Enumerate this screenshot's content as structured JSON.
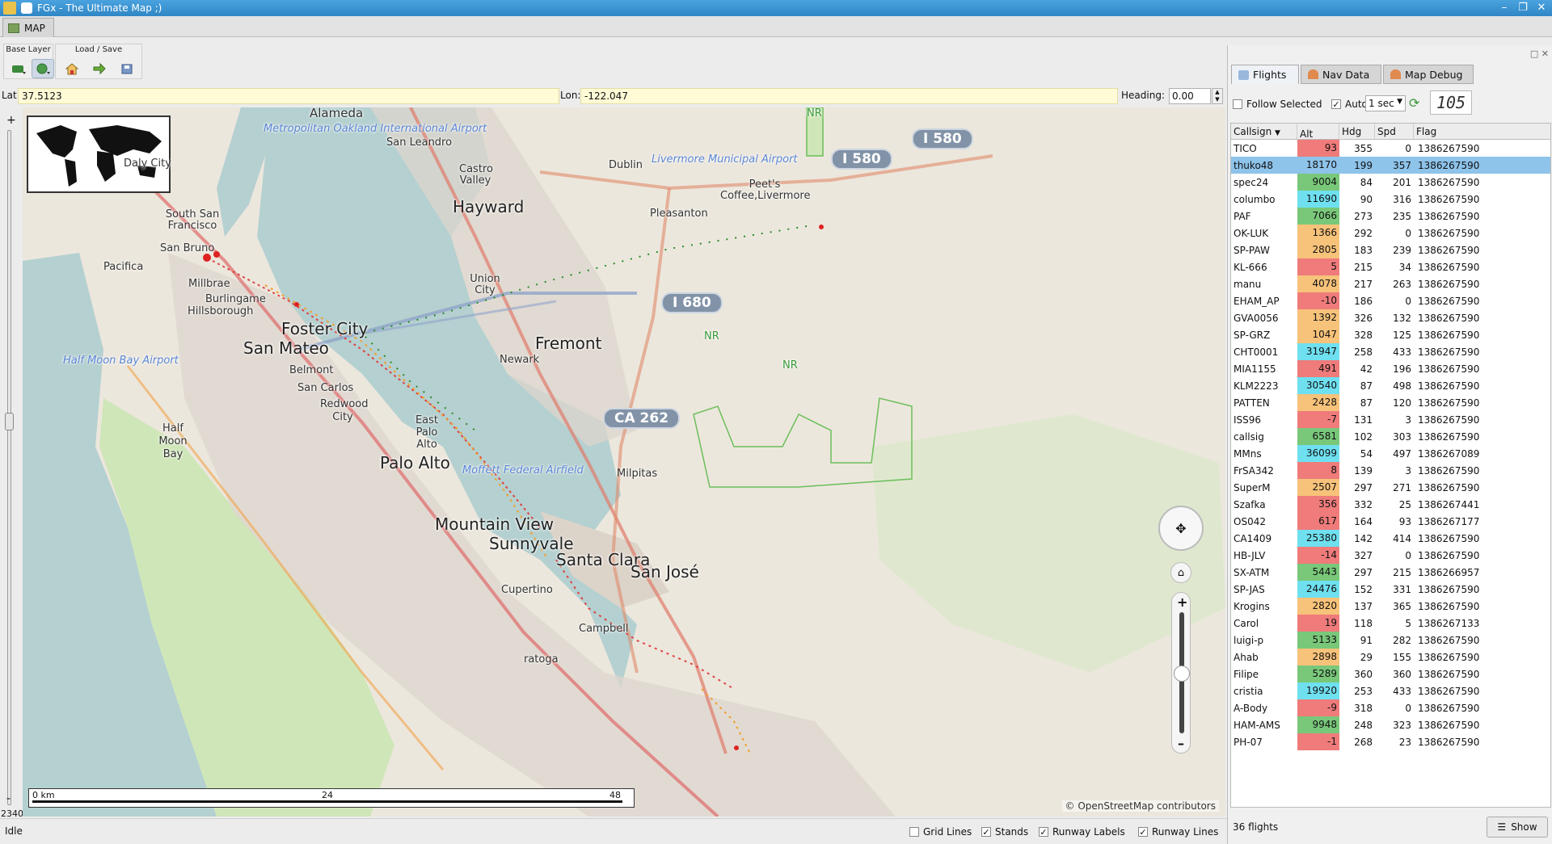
{
  "window": {
    "title": "FGx - The Ultimate Map ;)"
  },
  "main_tab": {
    "label": "MAP"
  },
  "toolbar": {
    "base_layer_label": "Base Layer",
    "load_save_label": "Load / Save",
    "buttons": [
      "layer-stack-icon",
      "globe-icon",
      "home-icon",
      "load-arrow-icon",
      "save-icon"
    ]
  },
  "coords": {
    "lat_label": "Lat:",
    "lat_value": "37.5123",
    "lon_label": "Lon:",
    "lon_value": "-122.047",
    "heading_label": "Heading:",
    "heading_value": "0.00"
  },
  "zoom_slider": {
    "value": "2340",
    "plus": "+",
    "minus": "-"
  },
  "map": {
    "labels": {
      "alameda": "Alameda",
      "oakland_airport": "Metropolitan Oakland International Airport",
      "san_leandro": "San Leandro",
      "daly_city": "Daly City",
      "south_sf": "South San Francisco",
      "castro_valley": "Castro Valley",
      "hayward": "Hayward",
      "dublin": "Dublin",
      "livermore_airport": "Livermore Municipal Airport",
      "peets": "Peet's Coffee,Livermore",
      "pleasanton": "Pleasanton",
      "san_bruno": "San Bruno",
      "pacifica": "Pacifica",
      "millbrae": "Millbrae",
      "burlingame": "Burlingame",
      "hillsborough": "Hillsborough",
      "union_city": "Union City",
      "foster_city": "Foster City",
      "san_mateo": "San Mateo",
      "fremont": "Fremont",
      "newark": "Newark",
      "hmb_airport": "Half Moon Bay Airport",
      "belmont": "Belmont",
      "san_carlos": "San Carlos",
      "redwood_city": "Redwood City",
      "half_moon_bay": "Half Moon Bay",
      "east_palo_alto": "East Palo Alto",
      "palo_alto": "Palo Alto",
      "moffett": "Moffett Federal Airfield",
      "milpitas": "Milpitas",
      "mountain_view": "Mountain View",
      "sunnyvale": "Sunnyvale",
      "santa_clara": "Santa Clara",
      "san_jose": "San José",
      "cupertino": "Cupertino",
      "campbell": "Campbell",
      "saratoga": "ratoga",
      "nr": "NR"
    },
    "shields": {
      "i580a": "I 580",
      "i580b": "I 580",
      "i680": "I 680",
      "ca262": "CA 262"
    },
    "scale": {
      "zero": "0 km",
      "mid": "24",
      "max": "48"
    },
    "attribution": "© OpenStreetMap contributors"
  },
  "statusbar": {
    "status": "Idle",
    "grid_lines": "Grid Lines",
    "grid_lines_checked": false,
    "stands": "Stands",
    "stands_checked": true,
    "runway_labels": "Runway Labels",
    "runway_labels_checked": true,
    "runway_lines": "Runway Lines",
    "runway_lines_checked": true
  },
  "panel": {
    "tabs": [
      "Flights",
      "Nav Data",
      "Map Debug"
    ],
    "follow_selected": "Follow Selected",
    "auto": "Auto",
    "interval": "1 sec",
    "counter": "105",
    "columns": [
      "Callsign",
      "Alt",
      "Hdg",
      "Spd",
      "Flag"
    ],
    "footer_count": "36 flights",
    "show_button": "Show"
  },
  "colors": {
    "alt_red": "#ef7b7b",
    "alt_orange": "#f7c27a",
    "alt_green": "#79c87a",
    "alt_cyan": "#6fe0f0",
    "selected_row": "#8ec3ea"
  },
  "flights": [
    {
      "callsign": "TICO",
      "alt": "93",
      "hdg": "355",
      "spd": "0",
      "flag": "1386267590",
      "band": "red"
    },
    {
      "callsign": "thuko48",
      "alt": "18170",
      "hdg": "199",
      "spd": "357",
      "flag": "1386267590",
      "band": "selected"
    },
    {
      "callsign": "spec24",
      "alt": "9004",
      "hdg": "84",
      "spd": "201",
      "flag": "1386267590",
      "band": "green"
    },
    {
      "callsign": "columbo",
      "alt": "11690",
      "hdg": "90",
      "spd": "316",
      "flag": "1386267590",
      "band": "cyan"
    },
    {
      "callsign": "PAF",
      "alt": "7066",
      "hdg": "273",
      "spd": "235",
      "flag": "1386267590",
      "band": "green"
    },
    {
      "callsign": "OK-LUK",
      "alt": "1366",
      "hdg": "292",
      "spd": "0",
      "flag": "1386267590",
      "band": "orange"
    },
    {
      "callsign": "SP-PAW",
      "alt": "2805",
      "hdg": "183",
      "spd": "239",
      "flag": "1386267590",
      "band": "orange"
    },
    {
      "callsign": "KL-666",
      "alt": "5",
      "hdg": "215",
      "spd": "34",
      "flag": "1386267590",
      "band": "red"
    },
    {
      "callsign": "manu",
      "alt": "4078",
      "hdg": "217",
      "spd": "263",
      "flag": "1386267590",
      "band": "orange"
    },
    {
      "callsign": "EHAM_AP",
      "alt": "-10",
      "hdg": "186",
      "spd": "0",
      "flag": "1386267590",
      "band": "red"
    },
    {
      "callsign": "GVA0056",
      "alt": "1392",
      "hdg": "326",
      "spd": "132",
      "flag": "1386267590",
      "band": "orange"
    },
    {
      "callsign": "SP-GRZ",
      "alt": "1047",
      "hdg": "328",
      "spd": "125",
      "flag": "1386267590",
      "band": "orange"
    },
    {
      "callsign": "CHT0001",
      "alt": "31947",
      "hdg": "258",
      "spd": "433",
      "flag": "1386267590",
      "band": "cyan"
    },
    {
      "callsign": "MIA1155",
      "alt": "491",
      "hdg": "42",
      "spd": "196",
      "flag": "1386267590",
      "band": "red"
    },
    {
      "callsign": "KLM2223",
      "alt": "30540",
      "hdg": "87",
      "spd": "498",
      "flag": "1386267590",
      "band": "cyan"
    },
    {
      "callsign": "PATTEN",
      "alt": "2428",
      "hdg": "87",
      "spd": "120",
      "flag": "1386267590",
      "band": "orange"
    },
    {
      "callsign": "ISS96",
      "alt": "-7",
      "hdg": "131",
      "spd": "3",
      "flag": "1386267590",
      "band": "red"
    },
    {
      "callsign": "callsig",
      "alt": "6581",
      "hdg": "102",
      "spd": "303",
      "flag": "1386267590",
      "band": "green"
    },
    {
      "callsign": "MMns",
      "alt": "36099",
      "hdg": "54",
      "spd": "497",
      "flag": "1386267089",
      "band": "cyan"
    },
    {
      "callsign": "FrSA342",
      "alt": "8",
      "hdg": "139",
      "spd": "3",
      "flag": "1386267590",
      "band": "red"
    },
    {
      "callsign": "SuperM",
      "alt": "2507",
      "hdg": "297",
      "spd": "271",
      "flag": "1386267590",
      "band": "orange"
    },
    {
      "callsign": "Szafka",
      "alt": "356",
      "hdg": "332",
      "spd": "25",
      "flag": "1386267441",
      "band": "red"
    },
    {
      "callsign": "OS042",
      "alt": "617",
      "hdg": "164",
      "spd": "93",
      "flag": "1386267177",
      "band": "red"
    },
    {
      "callsign": "CA1409",
      "alt": "25380",
      "hdg": "142",
      "spd": "414",
      "flag": "1386267590",
      "band": "cyan"
    },
    {
      "callsign": "HB-JLV",
      "alt": "-14",
      "hdg": "327",
      "spd": "0",
      "flag": "1386267590",
      "band": "red"
    },
    {
      "callsign": "SX-ATM",
      "alt": "5443",
      "hdg": "297",
      "spd": "215",
      "flag": "1386266957",
      "band": "green"
    },
    {
      "callsign": "SP-JAS",
      "alt": "24476",
      "hdg": "152",
      "spd": "331",
      "flag": "1386267590",
      "band": "cyan"
    },
    {
      "callsign": "Krogins",
      "alt": "2820",
      "hdg": "137",
      "spd": "365",
      "flag": "1386267590",
      "band": "orange"
    },
    {
      "callsign": "Carol",
      "alt": "19",
      "hdg": "118",
      "spd": "5",
      "flag": "1386267133",
      "band": "red"
    },
    {
      "callsign": "luigi-p",
      "alt": "5133",
      "hdg": "91",
      "spd": "282",
      "flag": "1386267590",
      "band": "green"
    },
    {
      "callsign": "Ahab",
      "alt": "2898",
      "hdg": "29",
      "spd": "155",
      "flag": "1386267590",
      "band": "orange"
    },
    {
      "callsign": "Filipe",
      "alt": "5289",
      "hdg": "360",
      "spd": "360",
      "flag": "1386267590",
      "band": "green"
    },
    {
      "callsign": "cristia",
      "alt": "19920",
      "hdg": "253",
      "spd": "433",
      "flag": "1386267590",
      "band": "cyan"
    },
    {
      "callsign": "A-Body",
      "alt": "-9",
      "hdg": "318",
      "spd": "0",
      "flag": "1386267590",
      "band": "red"
    },
    {
      "callsign": "HAM-AMS",
      "alt": "9948",
      "hdg": "248",
      "spd": "323",
      "flag": "1386267590",
      "band": "green"
    },
    {
      "callsign": "PH-07",
      "alt": "-1",
      "hdg": "268",
      "spd": "23",
      "flag": "1386267590",
      "band": "red"
    }
  ]
}
